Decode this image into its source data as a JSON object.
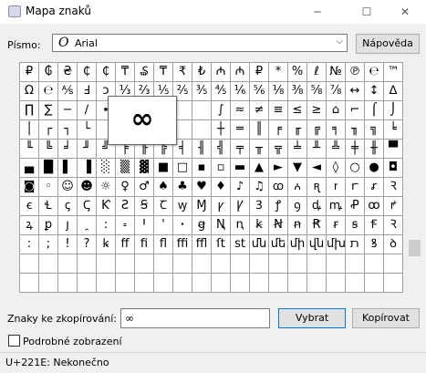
{
  "window": {
    "title": "Mapa znaků",
    "minimize": "─",
    "maximize": "☐",
    "close": "✕"
  },
  "font": {
    "label": "Písmo:",
    "icon": "O",
    "value": "Arial",
    "help_button": "Nápověda"
  },
  "grid": {
    "rows": [
      [
        "₽",
        "₲",
        "₴",
        "₵",
        "₵",
        "₸",
        "₷",
        "₸",
        "₹",
        "₺",
        "₼",
        "₼",
        "₽",
        "*",
        "%",
        "ℓ",
        "№",
        "℗",
        "℮",
        "™"
      ],
      [
        "Ω",
        "℮",
        "⅍",
        "Ⅎ",
        "ↄ",
        "⅓",
        "⅔",
        "⅕",
        "⅖",
        "⅗",
        "⅘",
        "⅙",
        "⅚",
        "⅛",
        "⅜",
        "⅝",
        "⅞",
        "↔",
        "↕",
        "∆"
      ],
      [
        "∏",
        "∑",
        "−",
        "∕",
        "∙",
        "",
        "",
        "",
        "",
        "",
        "∫",
        "≈",
        "≠",
        "≡",
        "≤",
        "≥",
        "⌂",
        "⌐",
        "⌠",
        "⌡"
      ],
      [
        "│",
        "┌",
        "┐",
        "└",
        "",
        "",
        "",
        "",
        "",
        "",
        "┼",
        "═",
        "║",
        "╒",
        "╓",
        "╔",
        "╕",
        "╖",
        "╗",
        "╘"
      ],
      [
        "╙",
        "╚",
        "╛",
        "╜",
        "╝",
        "╞",
        "╟",
        "╠",
        "╡",
        "╢",
        "╣",
        "╤",
        "╥",
        "╦",
        "╧",
        "╨",
        "╩",
        "╪",
        "╫",
        "▀"
      ],
      [
        "▄",
        "█",
        "▌",
        "▐",
        "░",
        "▒",
        "▓",
        "■",
        "□",
        "▪",
        "▫",
        "▬",
        "▲",
        "►",
        "▼",
        "◄",
        "◊",
        "○",
        "●",
        "◘"
      ],
      [
        "◙",
        "◦",
        "☺",
        "☻",
        "☼",
        "♀",
        "♂",
        "♠",
        "♣",
        "♥",
        "♦",
        "♪",
        "♫",
        "ꭃ",
        "ꭅ",
        "ꭆ",
        "ꭇ",
        "ꭈ",
        "ꭉ",
        "Ꝛ"
      ],
      [
        "ꞓ",
        "Ɬ",
        "ꞔ",
        "Ꞔ",
        "Ƙ",
        "Ƨ",
        "Ꞩ",
        "Ꞇ",
        "ꝡ",
        "Ɱ",
        "ꝩ",
        "Ꝩ",
        "Ꝫ",
        "ꝭ",
        "ꝯ",
        "ꝱ",
        "ꝳ",
        "Ꝓ",
        "ꝏ",
        "ꝵ"
      ],
      [
        "ꝝ",
        "ꝑ",
        "ȷ",
        "ꞈ",
        "꞉",
        "꞊",
        "Ꞌ",
        "ꞌ",
        "ꞏ",
        "ꞡ",
        "Ꞑ",
        "ꞑ",
        "ꞣ",
        "Ꞥ",
        "ꞥ",
        "Ꞧ",
        "ꞧ",
        "ꞩ",
        "Ꞙ",
        "Ꝛ"
      ],
      [
        ":",
        ";",
        "!",
        "?",
        "ꝃ",
        "ff",
        "fi",
        "fl",
        "ffi",
        "ffl",
        "ſt",
        "st",
        "մն",
        "մե",
        "մի",
        "վն",
        "մխ",
        "ﬨ",
        "ꝸ",
        "ꝺ"
      ],
      [
        "",
        "",
        "",
        "",
        "",
        "",
        "",
        "",
        "",
        "",
        "",
        "",
        "",
        "",
        "",
        "",
        "",
        "",
        "",
        ""
      ],
      [
        "",
        "",
        "",
        "",
        "",
        "",
        "",
        "",
        "",
        "",
        "",
        "",
        "",
        "",
        "",
        "",
        "",
        "",
        "",
        ""
      ]
    ],
    "magnified_char": "∞"
  },
  "copy": {
    "label": "Znaky ke zkopírování:",
    "value": "∞",
    "select_button": "Vybrat",
    "copy_button": "Kopírovat"
  },
  "advanced": {
    "label": "Podrobné zobrazení"
  },
  "status": {
    "text": "U+221E: Nekonečno"
  }
}
